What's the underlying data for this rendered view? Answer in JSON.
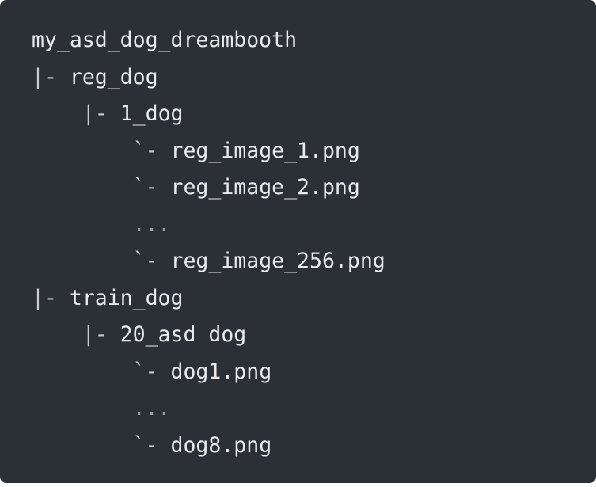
{
  "code_block": {
    "lines": [
      {
        "indent": "",
        "prefix": "",
        "text": "my_asd_dog_dreambooth"
      },
      {
        "indent": "",
        "prefix": "|- ",
        "text": "reg_dog"
      },
      {
        "indent": "    ",
        "prefix": "|- ",
        "text": "1_dog"
      },
      {
        "indent": "        ",
        "prefix": "`- ",
        "text": "reg_image_1.png"
      },
      {
        "indent": "        ",
        "prefix": "`- ",
        "text": "reg_image_2.png"
      },
      {
        "indent": "        ",
        "prefix": "",
        "text": "..."
      },
      {
        "indent": "        ",
        "prefix": "`- ",
        "text": "reg_image_256.png"
      },
      {
        "indent": "",
        "prefix": "|- ",
        "text": "train_dog"
      },
      {
        "indent": "    ",
        "prefix": "|- ",
        "text": "20_asd dog"
      },
      {
        "indent": "        ",
        "prefix": "`- ",
        "text": "dog1.png"
      },
      {
        "indent": "        ",
        "prefix": "",
        "text": "..."
      },
      {
        "indent": "        ",
        "prefix": "`- ",
        "text": "dog8.png"
      }
    ]
  },
  "colors": {
    "background": "#2b2f36",
    "text": "#e8eaed"
  }
}
